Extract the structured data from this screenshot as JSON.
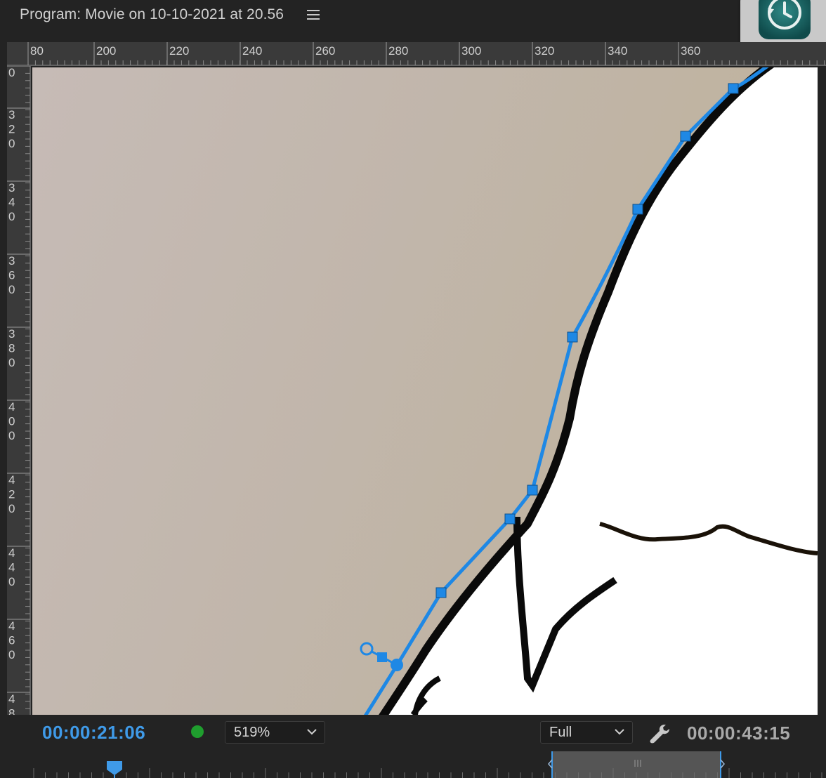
{
  "panel": {
    "title": "Program: Movie on 10-10-2021 at 20.56",
    "menu_icon": "hamburger-menu-icon"
  },
  "dock": {
    "app_icon": "time-machine-icon"
  },
  "ruler_h": {
    "labels": [
      "80",
      "200",
      "220",
      "240",
      "260",
      "280",
      "300",
      "320",
      "340",
      "360"
    ]
  },
  "ruler_v": {
    "labels": [
      [
        "0"
      ],
      [
        "3",
        "2",
        "0"
      ],
      [
        "3",
        "4",
        "0"
      ],
      [
        "3",
        "6",
        "0"
      ],
      [
        "3",
        "8",
        "0"
      ],
      [
        "4",
        "0",
        "0"
      ],
      [
        "4",
        "2",
        "0"
      ],
      [
        "4",
        "4",
        "0"
      ],
      [
        "4",
        "6",
        "0"
      ],
      [
        "4",
        "8"
      ]
    ]
  },
  "viewer": {
    "mask_color": "#1e88e5",
    "background_color": "#c2b7ad"
  },
  "controls": {
    "current_timecode": "00:00:21:06",
    "status_color": "#1f9e2e",
    "zoom_value": "519%",
    "quality_value": "Full",
    "duration_timecode": "00:00:43:15",
    "wrench_icon": "wrench-icon",
    "playhead_color": "#3f9ae8"
  }
}
